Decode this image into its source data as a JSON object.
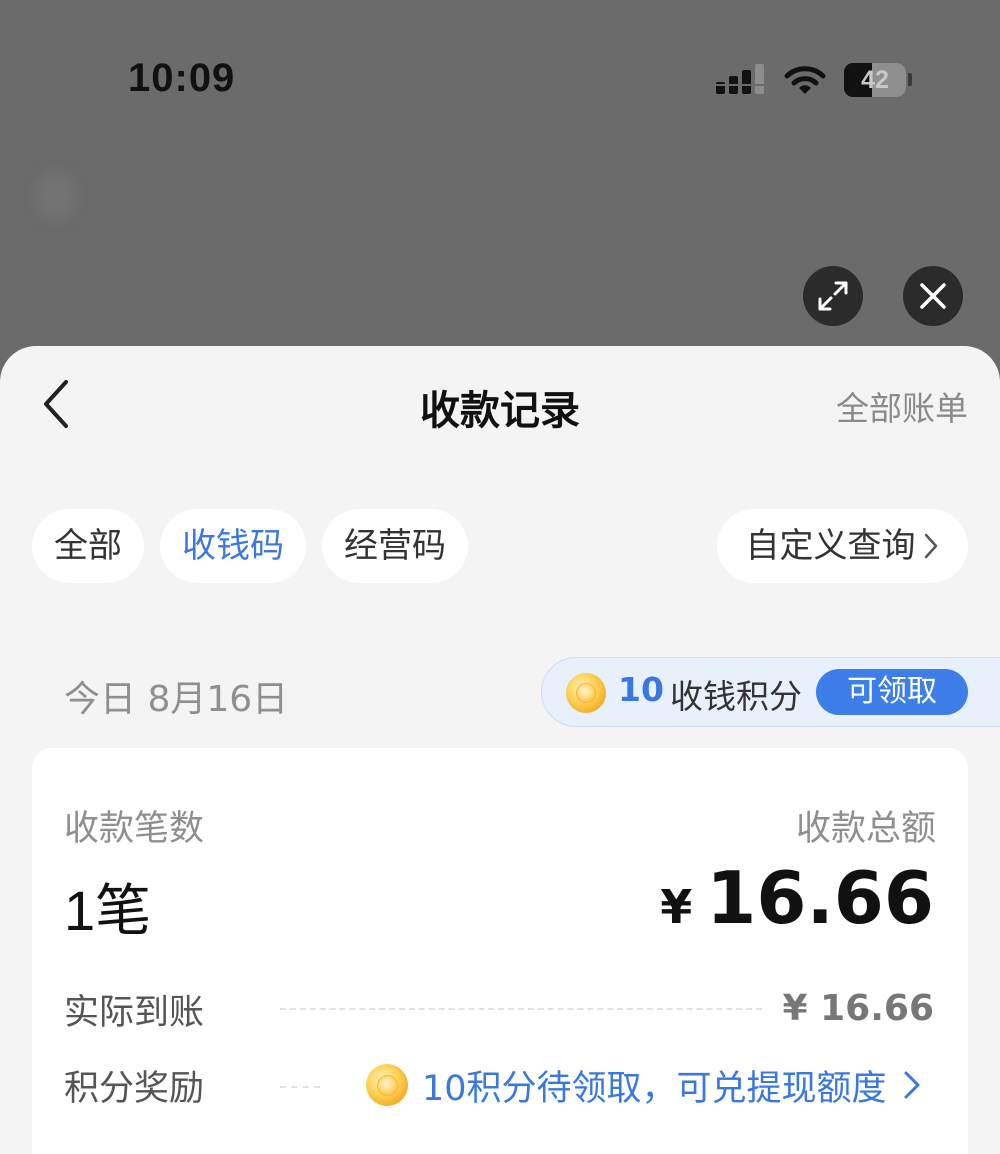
{
  "status_bar": {
    "time": "10:09",
    "battery": "42"
  },
  "overlay_controls": {
    "expand_icon": "expand-arrows-icon",
    "close_icon": "close-icon"
  },
  "nav": {
    "title": "收款记录",
    "right_link": "全部账单",
    "back_icon": "chevron-left-icon"
  },
  "filters": {
    "chips": [
      {
        "label": "全部",
        "selected": false
      },
      {
        "label": "收钱码",
        "selected": true
      },
      {
        "label": "经营码",
        "selected": false
      }
    ],
    "custom_query": "自定义查询"
  },
  "day": {
    "label": "今日 8月16日"
  },
  "points_banner": {
    "count": "10",
    "text": "收钱积分",
    "button": "可领取"
  },
  "summary": {
    "count_label": "收款笔数",
    "count_value": "1笔",
    "total_label": "收款总额",
    "currency": "¥",
    "total_value": "16.66",
    "actual_label": "实际到账",
    "actual_value": "¥ 16.66",
    "points_label": "积分奖励",
    "points_text": "10积分待领取，可兑提现额度"
  },
  "colors": {
    "accent": "#3a78e0",
    "button_blue": "#3d7ee8",
    "sheet_bg": "#f4f4f4",
    "backdrop": "#6b6b6b"
  }
}
